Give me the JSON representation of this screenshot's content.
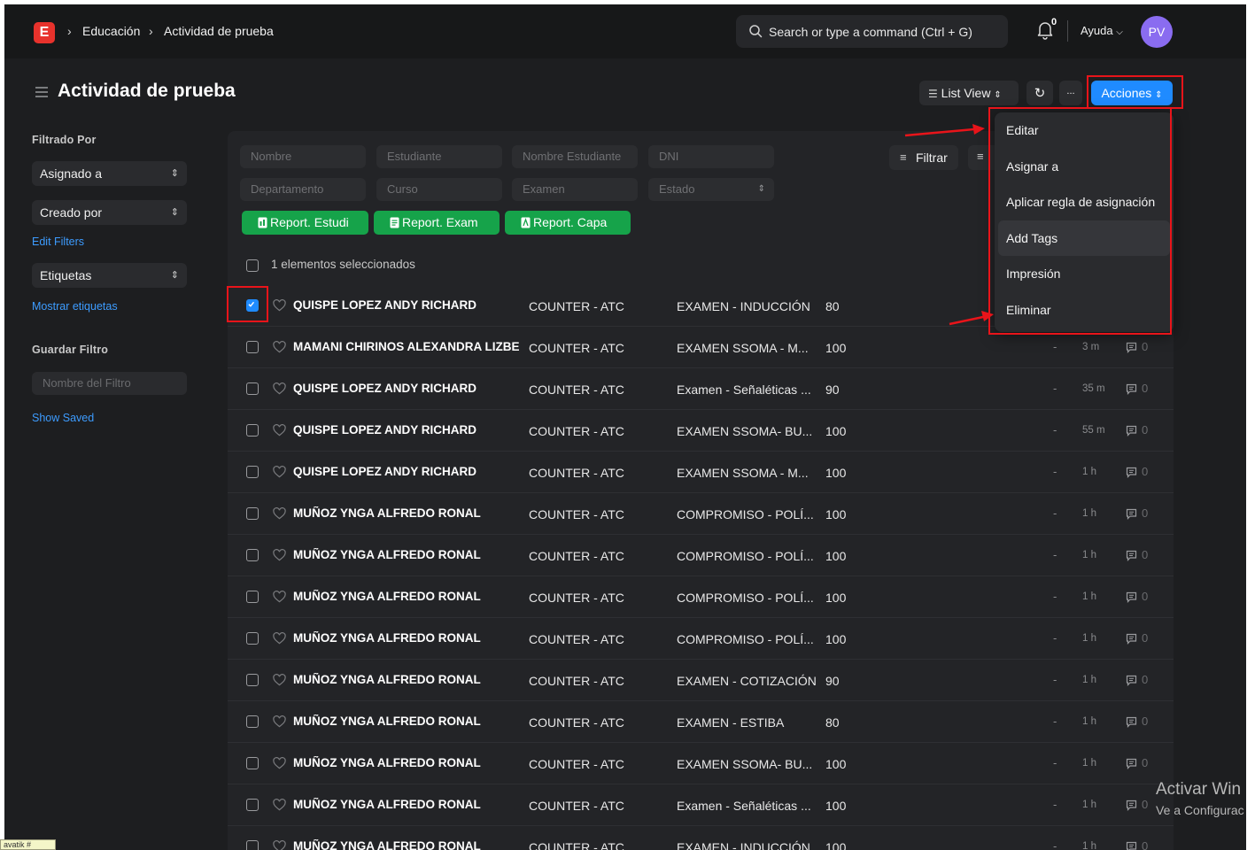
{
  "navbar": {
    "logo": "E",
    "breadcrumbs": [
      "Educación",
      "Actividad de prueba"
    ],
    "search_placeholder": "Search or type a command (Ctrl + G)",
    "notification_count": "0",
    "help_label": "Ayuda",
    "avatar_initials": "PV"
  },
  "page": {
    "title": "Actividad de prueba",
    "list_view_label": "List View",
    "more_label": "...",
    "actions_label": "Acciones"
  },
  "sidebar": {
    "filter_by_label": "Filtrado Por",
    "assigned_to": "Asignado a",
    "created_by": "Creado por",
    "edit_filters": "Edit Filters",
    "tags": "Etiquetas",
    "show_tags": "Mostrar etiquetas",
    "save_filter_label": "Guardar Filtro",
    "filter_name_placeholder": "Nombre del Filtro",
    "show_saved": "Show Saved"
  },
  "filters": {
    "nombre": "Nombre",
    "estudiante": "Estudiante",
    "nombre_estudiante": "Nombre Estudiante",
    "dni": "DNI",
    "departamento": "Departamento",
    "curso": "Curso",
    "examen": "Examen",
    "estado": "Estado",
    "filter_button": "Filtrar"
  },
  "reports": {
    "estudi": "Report. Estudi",
    "exam": "Report. Exam",
    "capa": "Report. Capa"
  },
  "list": {
    "selected_text": "1 elementos seleccionados",
    "rows": [
      {
        "name": "QUISPE LOPEZ ANDY RICHARD",
        "dept": "COUNTER - ATC",
        "exam": "EXAMEN - INDUCCIÓN",
        "score": "80",
        "dash": "",
        "time": "",
        "comments": "",
        "checked": true
      },
      {
        "name": "MAMANI CHIRINOS ALEXANDRA LIZBE",
        "dept": "COUNTER - ATC",
        "exam": "EXAMEN SSOMA - M...",
        "score": "100",
        "dash": "-",
        "time": "3 m",
        "comments": "0",
        "checked": false
      },
      {
        "name": "QUISPE LOPEZ ANDY RICHARD",
        "dept": "COUNTER - ATC",
        "exam": "Examen - Señaléticas ...",
        "score": "90",
        "dash": "-",
        "time": "35 m",
        "comments": "0",
        "checked": false
      },
      {
        "name": "QUISPE LOPEZ ANDY RICHARD",
        "dept": "COUNTER - ATC",
        "exam": "EXAMEN SSOMA- BU...",
        "score": "100",
        "dash": "-",
        "time": "55 m",
        "comments": "0",
        "checked": false
      },
      {
        "name": "QUISPE LOPEZ ANDY RICHARD",
        "dept": "COUNTER - ATC",
        "exam": "EXAMEN SSOMA - M...",
        "score": "100",
        "dash": "-",
        "time": "1 h",
        "comments": "0",
        "checked": false
      },
      {
        "name": "MUÑOZ YNGA ALFREDO RONAL",
        "dept": "COUNTER - ATC",
        "exam": "COMPROMISO - POLÍ...",
        "score": "100",
        "dash": "-",
        "time": "1 h",
        "comments": "0",
        "checked": false
      },
      {
        "name": "MUÑOZ YNGA ALFREDO RONAL",
        "dept": "COUNTER - ATC",
        "exam": "COMPROMISO - POLÍ...",
        "score": "100",
        "dash": "-",
        "time": "1 h",
        "comments": "0",
        "checked": false
      },
      {
        "name": "MUÑOZ YNGA ALFREDO RONAL",
        "dept": "COUNTER - ATC",
        "exam": "COMPROMISO - POLÍ...",
        "score": "100",
        "dash": "-",
        "time": "1 h",
        "comments": "0",
        "checked": false
      },
      {
        "name": "MUÑOZ YNGA ALFREDO RONAL",
        "dept": "COUNTER - ATC",
        "exam": "COMPROMISO - POLÍ...",
        "score": "100",
        "dash": "-",
        "time": "1 h",
        "comments": "0",
        "checked": false
      },
      {
        "name": "MUÑOZ YNGA ALFREDO RONAL",
        "dept": "COUNTER - ATC",
        "exam": "EXAMEN - COTIZACIÓN",
        "score": "90",
        "dash": "-",
        "time": "1 h",
        "comments": "0",
        "checked": false
      },
      {
        "name": "MUÑOZ YNGA ALFREDO RONAL",
        "dept": "COUNTER - ATC",
        "exam": "EXAMEN - ESTIBA",
        "score": "80",
        "dash": "-",
        "time": "1 h",
        "comments": "0",
        "checked": false
      },
      {
        "name": "MUÑOZ YNGA ALFREDO RONAL",
        "dept": "COUNTER - ATC",
        "exam": "EXAMEN SSOMA- BU...",
        "score": "100",
        "dash": "-",
        "time": "1 h",
        "comments": "0",
        "checked": false
      },
      {
        "name": "MUÑOZ YNGA ALFREDO RONAL",
        "dept": "COUNTER - ATC",
        "exam": "Examen - Señaléticas ...",
        "score": "100",
        "dash": "-",
        "time": "1 h",
        "comments": "0",
        "checked": false
      },
      {
        "name": "MUÑOZ YNGA ALFREDO RONAL",
        "dept": "COUNTER - ATC",
        "exam": "EXAMEN - INDUCCIÓN",
        "score": "100",
        "dash": "-",
        "time": "1 h",
        "comments": "0",
        "checked": false
      }
    ]
  },
  "actions_menu": {
    "items": [
      "Editar",
      "Asignar a",
      "Aplicar regla de asignación",
      "Add Tags",
      "Impresión",
      "Eliminar"
    ]
  },
  "overlays": {
    "watermark_title": "Activar Win",
    "watermark_sub": "Ve a Configurac",
    "tooltip": "avatik #"
  },
  "colors": {
    "accent": "#1f8bff",
    "report_green": "#16a34a",
    "annotation_red": "#e8141a",
    "logo_red": "#e8322c",
    "avatar_purple": "#8a6cf0"
  }
}
